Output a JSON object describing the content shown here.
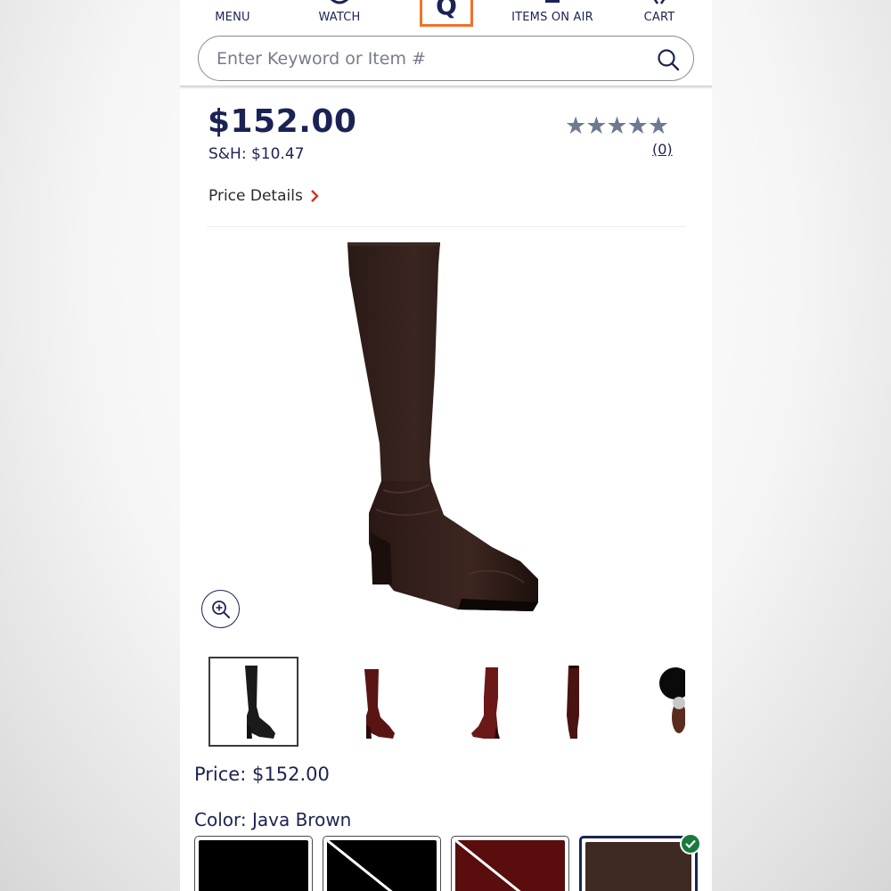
{
  "nav": {
    "menu_label": "MENU",
    "watch_label": "WATCH",
    "items_on_air_label": "ITEMS ON AIR",
    "cart_label": "CART",
    "logo_letter": "Q"
  },
  "search": {
    "placeholder": "Enter Keyword or Item #"
  },
  "product": {
    "price": "$152.00",
    "shipping": "S&H: $10.47",
    "rating_stars": "★★★★★",
    "rating_count": "(0)",
    "price_details_label": "Price Details",
    "price_line_label": "Price:",
    "price_line_value": "$152.00",
    "color_label": "Color:",
    "color_value": "Java Brown"
  },
  "swatches": [
    {
      "color": "#000000",
      "available": true
    },
    {
      "color": "#000000",
      "available": false
    },
    {
      "color": "#5a0d0d",
      "available": false
    },
    {
      "color": "#3e2a22",
      "available": true,
      "selected": true
    }
  ],
  "thumbnails": [
    {
      "color": "#1a1a1a",
      "selected": true
    },
    {
      "color": "#5a1414"
    },
    {
      "color": "#6a1818"
    },
    {
      "color": "#4a1210"
    },
    {
      "color": "#2b1410"
    }
  ],
  "colors": {
    "navy": "#1b2354",
    "accent_orange": "#f0712a",
    "accent_red": "#d2331b",
    "star_gray": "#6e7a92",
    "check_green": "#1a7a3c"
  }
}
